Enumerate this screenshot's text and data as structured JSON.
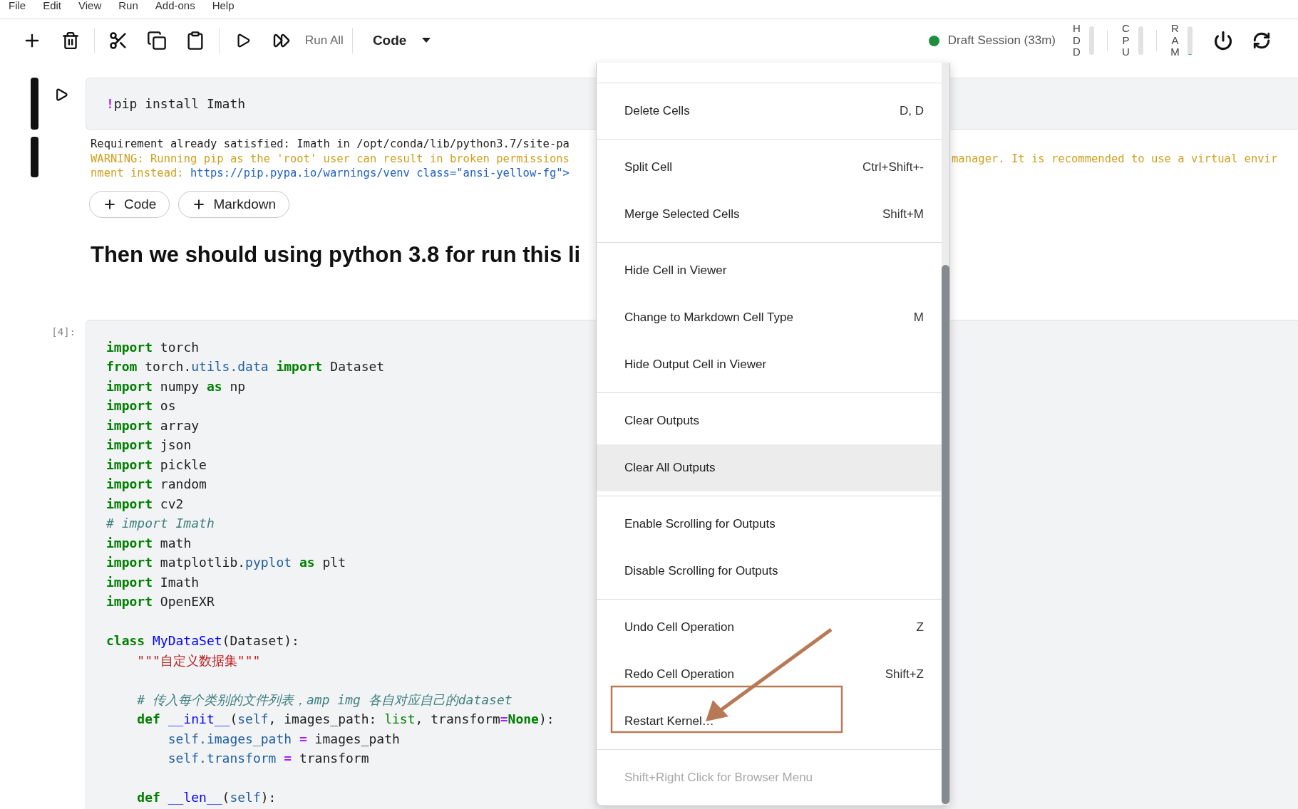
{
  "menubar": [
    "File",
    "Edit",
    "View",
    "Run",
    "Add-ons",
    "Help"
  ],
  "toolbar": {
    "run_all": "Run All",
    "cell_type": "Code",
    "session": {
      "label": "Draft Session (33m)",
      "connected": true
    },
    "meters": [
      {
        "label": "HDD",
        "level": 0
      },
      {
        "label": "CPU",
        "level": 0
      },
      {
        "label": "RAM",
        "level": 0.03
      }
    ]
  },
  "pip_cell": {
    "input": [
      {
        "kind": "op",
        "text": "!"
      },
      {
        "kind": "plain",
        "text": "pip install Imath"
      }
    ],
    "output": [
      {
        "left": [
          {
            "kind": "plain",
            "text": "Requirement already satisfied: Imath in /opt/conda/lib/python3.7/site-pa"
          }
        ]
      },
      {
        "left": [
          {
            "kind": "warning",
            "text": "WARNING: Running pip as the 'root' user can result in broken permissions"
          }
        ],
        "right": [
          {
            "kind": "warning",
            "text": "manager. It is recommended to use a virtual envir"
          }
        ]
      },
      {
        "left": [
          {
            "kind": "warning",
            "text": "nment instead: "
          },
          {
            "kind": "link",
            "text": "https://pip.pypa.io/warnings/venv class=\"ansi-yellow-fg\">"
          }
        ]
      }
    ]
  },
  "add_buttons": [
    "Code",
    "Markdown"
  ],
  "heading": "Then we should using python 3.8 for run this li",
  "code_cell": {
    "prompt": "[4]:",
    "lines": [
      {
        "kind": "code",
        "tokens": [
          {
            "kind": "keyword",
            "text": "import"
          },
          {
            "kind": "plain",
            "text": " torch"
          }
        ]
      },
      {
        "kind": "code",
        "tokens": [
          {
            "kind": "keyword",
            "text": "from"
          },
          {
            "kind": "plain",
            "text": " torch."
          },
          {
            "kind": "attr",
            "text": "utils.data"
          },
          {
            "kind": "keyword",
            "text": " import"
          },
          {
            "kind": "plain",
            "text": " Dataset"
          }
        ]
      },
      {
        "kind": "code",
        "tokens": [
          {
            "kind": "keyword",
            "text": "import"
          },
          {
            "kind": "plain",
            "text": " numpy "
          },
          {
            "kind": "keyword",
            "text": "as"
          },
          {
            "kind": "plain",
            "text": " np"
          }
        ]
      },
      {
        "kind": "code",
        "tokens": [
          {
            "kind": "keyword",
            "text": "import"
          },
          {
            "kind": "plain",
            "text": " os"
          }
        ]
      },
      {
        "kind": "code",
        "tokens": [
          {
            "kind": "keyword",
            "text": "import"
          },
          {
            "kind": "plain",
            "text": " array"
          }
        ]
      },
      {
        "kind": "code",
        "tokens": [
          {
            "kind": "keyword",
            "text": "import"
          },
          {
            "kind": "plain",
            "text": " json"
          }
        ]
      },
      {
        "kind": "code",
        "tokens": [
          {
            "kind": "keyword",
            "text": "import"
          },
          {
            "kind": "plain",
            "text": " pickle"
          }
        ]
      },
      {
        "kind": "code",
        "tokens": [
          {
            "kind": "keyword",
            "text": "import"
          },
          {
            "kind": "plain",
            "text": " random"
          }
        ]
      },
      {
        "kind": "code",
        "tokens": [
          {
            "kind": "keyword",
            "text": "import"
          },
          {
            "kind": "plain",
            "text": " cv2"
          }
        ]
      },
      {
        "kind": "code",
        "tokens": [
          {
            "kind": "comment",
            "text": "# import Imath"
          }
        ]
      },
      {
        "kind": "code",
        "tokens": [
          {
            "kind": "keyword",
            "text": "import"
          },
          {
            "kind": "plain",
            "text": " math"
          }
        ]
      },
      {
        "kind": "code",
        "tokens": [
          {
            "kind": "keyword",
            "text": "import"
          },
          {
            "kind": "plain",
            "text": " matplotlib."
          },
          {
            "kind": "attr",
            "text": "pyplot"
          },
          {
            "kind": "keyword",
            "text": " as"
          },
          {
            "kind": "plain",
            "text": " plt"
          }
        ]
      },
      {
        "kind": "code",
        "tokens": [
          {
            "kind": "keyword",
            "text": "import"
          },
          {
            "kind": "plain",
            "text": " Imath"
          }
        ]
      },
      {
        "kind": "code",
        "tokens": [
          {
            "kind": "keyword",
            "text": "import"
          },
          {
            "kind": "plain",
            "text": " OpenEXR"
          }
        ]
      },
      {
        "kind": "blank"
      },
      {
        "kind": "code",
        "tokens": [
          {
            "kind": "keyword",
            "text": "class"
          },
          {
            "kind": "name",
            "text": " MyDataSet"
          },
          {
            "kind": "plain",
            "text": "(Dataset):"
          }
        ]
      },
      {
        "kind": "code",
        "tokens": [
          {
            "kind": "string",
            "text": "    \"\"\"自定义数据集\"\"\""
          }
        ]
      },
      {
        "kind": "blank"
      },
      {
        "kind": "code",
        "tokens": [
          {
            "kind": "comment",
            "text": "    # 传入每个类别的文件列表，amp img 各自对应自己的dataset"
          }
        ]
      },
      {
        "kind": "code",
        "tokens": [
          {
            "kind": "keyword",
            "text": "    def"
          },
          {
            "kind": "name",
            "text": " __init__"
          },
          {
            "kind": "plain",
            "text": "("
          },
          {
            "kind": "attr",
            "text": "self"
          },
          {
            "kind": "plain",
            "text": ", images_path: "
          },
          {
            "kind": "builtin",
            "text": "list"
          },
          {
            "kind": "plain",
            "text": ", transform"
          },
          {
            "kind": "op",
            "text": "="
          },
          {
            "kind": "keyword",
            "text": "None"
          },
          {
            "kind": "plain",
            "text": "):"
          }
        ]
      },
      {
        "kind": "code",
        "tokens": [
          {
            "kind": "attr",
            "text": "        self.images_path"
          },
          {
            "kind": "op",
            "text": " ="
          },
          {
            "kind": "plain",
            "text": " images_path"
          }
        ]
      },
      {
        "kind": "code",
        "tokens": [
          {
            "kind": "attr",
            "text": "        self.transform"
          },
          {
            "kind": "op",
            "text": " ="
          },
          {
            "kind": "plain",
            "text": " transform"
          }
        ]
      },
      {
        "kind": "blank"
      },
      {
        "kind": "code",
        "tokens": [
          {
            "kind": "keyword",
            "text": "    def"
          },
          {
            "kind": "name",
            "text": " __len__"
          },
          {
            "kind": "plain",
            "text": "("
          },
          {
            "kind": "attr",
            "text": "self"
          },
          {
            "kind": "plain",
            "text": "):"
          }
        ]
      }
    ]
  },
  "context_menu": {
    "sections": [
      [
        {
          "label": "Delete Cells",
          "shortcut": "D, D",
          "selected": false,
          "disabled": false
        }
      ],
      [
        {
          "label": "Split Cell",
          "shortcut": "Ctrl+Shift+-",
          "selected": false,
          "disabled": false
        },
        {
          "label": "Merge Selected Cells",
          "shortcut": "Shift+M",
          "selected": false,
          "disabled": false
        }
      ],
      [
        {
          "label": "Hide Cell in Viewer",
          "selected": false,
          "disabled": false
        },
        {
          "label": "Change to Markdown Cell Type",
          "shortcut": "M",
          "selected": false,
          "disabled": false
        },
        {
          "label": "Hide Output Cell in Viewer",
          "selected": false,
          "disabled": false
        }
      ],
      [
        {
          "label": "Clear Outputs",
          "selected": false,
          "disabled": false
        },
        {
          "label": "Clear All Outputs",
          "selected": true,
          "disabled": false
        }
      ],
      [
        {
          "label": "Enable Scrolling for Outputs",
          "selected": false,
          "disabled": false
        },
        {
          "label": "Disable Scrolling for Outputs",
          "selected": false,
          "disabled": false
        }
      ],
      [
        {
          "label": "Undo Cell Operation",
          "shortcut": "Z",
          "selected": false,
          "disabled": false
        },
        {
          "label": "Redo Cell Operation",
          "shortcut": "Shift+Z",
          "selected": false,
          "disabled": false
        },
        {
          "label": "Restart Kernel…",
          "selected": false,
          "disabled": false
        }
      ],
      [
        {
          "label": "Shift+Right Click for Browser Menu",
          "selected": false,
          "disabled": true
        }
      ]
    ]
  }
}
